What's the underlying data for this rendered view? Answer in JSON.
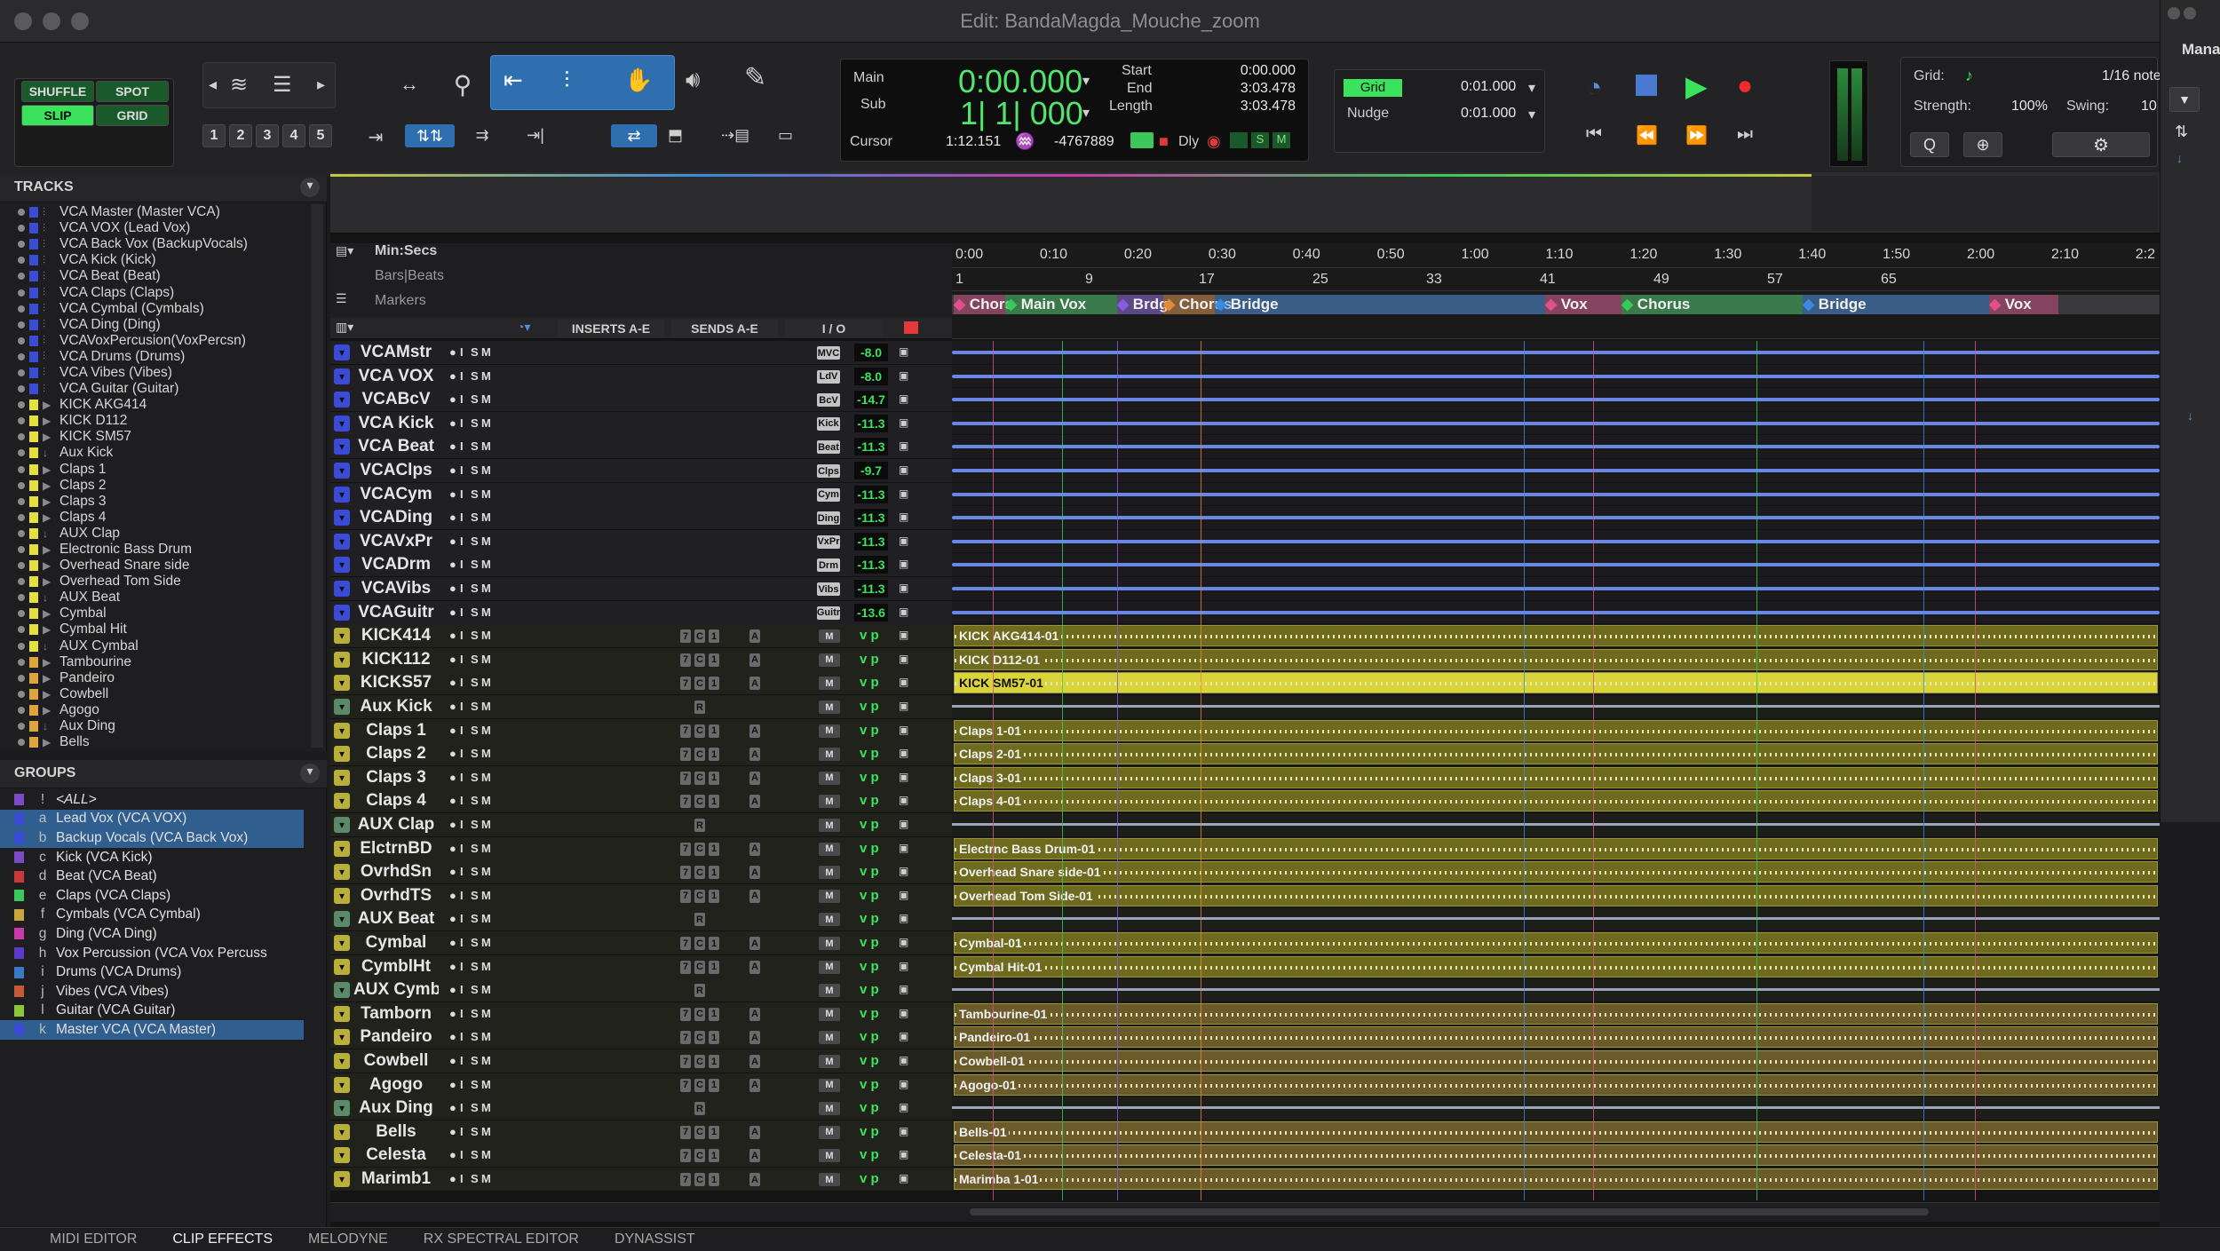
{
  "window": {
    "title": "Edit: BandaMagda_Mouche_zoom"
  },
  "edit_modes": {
    "shuffle": "SHUFFLE",
    "spot": "SPOT",
    "slip": "SLIP",
    "grid": "GRID"
  },
  "zoom_presets": [
    "1",
    "2",
    "3",
    "4",
    "5"
  ],
  "counter": {
    "main_label": "Main",
    "sub_label": "Sub",
    "main_value": "0:00.000",
    "sub_value": "1| 1| 000",
    "start_label": "Start",
    "end_label": "End",
    "length_label": "Length",
    "start_value": "0:00.000",
    "end_value": "3:03.478",
    "length_value": "3:03.478",
    "cursor_label": "Cursor",
    "cursor_value": "1:12.151",
    "cursor_offset": "-4767889",
    "dly_label": "Dly"
  },
  "grid_nudge": {
    "grid_label": "Grid",
    "grid_value": "0:01.000",
    "nudge_label": "Nudge",
    "nudge_value": "0:01.000"
  },
  "midi_panel": {
    "grid_label": "Grid:",
    "grid_value": "1/16 note",
    "strength_label": "Strength:",
    "strength_value": "100%",
    "swing_label": "Swing:",
    "swing_value": "10",
    "manager_label": "Mana"
  },
  "tracks_panel": {
    "title": "TRACKS",
    "items": [
      {
        "name": "VCA Master (Master VCA)",
        "color": "#3a4bd6"
      },
      {
        "name": "VCA VOX (Lead Vox)",
        "color": "#3a4bd6"
      },
      {
        "name": "VCA Back Vox (BackupVocals)",
        "color": "#3a4bd6"
      },
      {
        "name": "VCA Kick (Kick)",
        "color": "#3a4bd6"
      },
      {
        "name": "VCA Beat (Beat)",
        "color": "#3a4bd6"
      },
      {
        "name": "VCA Claps (Claps)",
        "color": "#3a4bd6"
      },
      {
        "name": "VCA Cymbal (Cymbals)",
        "color": "#3a4bd6"
      },
      {
        "name": "VCA Ding (Ding)",
        "color": "#3a4bd6"
      },
      {
        "name": "VCAVoxPercusion(VoxPercsn)",
        "color": "#3a4bd6"
      },
      {
        "name": "VCA Drums (Drums)",
        "color": "#3a4bd6"
      },
      {
        "name": "VCA Vibes (Vibes)",
        "color": "#3a4bd6"
      },
      {
        "name": "VCA Guitar (Guitar)",
        "color": "#3a4bd6"
      },
      {
        "name": "KICK AKG414",
        "color": "#e6e03a"
      },
      {
        "name": "KICK D112",
        "color": "#e6e03a"
      },
      {
        "name": "KICK SM57",
        "color": "#e6e03a"
      },
      {
        "name": "Aux Kick",
        "color": "#e6e03a"
      },
      {
        "name": "Claps 1",
        "color": "#e6e03a"
      },
      {
        "name": "Claps 2",
        "color": "#e6e03a"
      },
      {
        "name": "Claps 3",
        "color": "#e6e03a"
      },
      {
        "name": "Claps 4",
        "color": "#e6e03a"
      },
      {
        "name": "AUX Clap",
        "color": "#e6e03a"
      },
      {
        "name": "Electronic Bass Drum",
        "color": "#e6e03a"
      },
      {
        "name": "Overhead Snare side",
        "color": "#e6e03a"
      },
      {
        "name": "Overhead Tom Side",
        "color": "#e6e03a"
      },
      {
        "name": "AUX Beat",
        "color": "#e6e03a"
      },
      {
        "name": "Cymbal",
        "color": "#e6e03a"
      },
      {
        "name": "Cymbal Hit",
        "color": "#e6e03a"
      },
      {
        "name": "AUX Cymbal",
        "color": "#e6e03a"
      },
      {
        "name": "Tambourine",
        "color": "#e0a43a"
      },
      {
        "name": "Pandeiro",
        "color": "#e0a43a"
      },
      {
        "name": "Cowbell",
        "color": "#e0a43a"
      },
      {
        "name": "Agogo",
        "color": "#e0a43a"
      },
      {
        "name": "Aux Ding",
        "color": "#e0a43a"
      },
      {
        "name": "Bells",
        "color": "#e0a43a"
      }
    ]
  },
  "groups_panel": {
    "title": "GROUPS",
    "items": [
      {
        "letter": "!",
        "name": "<ALL>",
        "color": "#7a4ac8",
        "selected": false
      },
      {
        "letter": "a",
        "name": "Lead Vox (VCA VOX)",
        "color": "#3a4bd6",
        "selected": true
      },
      {
        "letter": "b",
        "name": "Backup Vocals (VCA Back Vox)",
        "color": "#3a4bd6",
        "selected": true
      },
      {
        "letter": "c",
        "name": "Kick (VCA Kick)",
        "color": "#7a4ac8",
        "selected": false
      },
      {
        "letter": "d",
        "name": "Beat (VCA Beat)",
        "color": "#c83a3a",
        "selected": false
      },
      {
        "letter": "e",
        "name": "Claps (VCA Claps)",
        "color": "#3ac85a",
        "selected": false
      },
      {
        "letter": "f",
        "name": "Cymbals (VCA Cymbal)",
        "color": "#c8a83a",
        "selected": false
      },
      {
        "letter": "g",
        "name": "Ding (VCA Ding)",
        "color": "#c83aa8",
        "selected": false
      },
      {
        "letter": "h",
        "name": "Vox Percussion (VCA Vox Percuss",
        "color": "#5a3ac8",
        "selected": false
      },
      {
        "letter": "i",
        "name": "Drums (VCA Drums)",
        "color": "#3a78c8",
        "selected": false
      },
      {
        "letter": "j",
        "name": "Vibes (VCA Vibes)",
        "color": "#c85a3a",
        "selected": false
      },
      {
        "letter": "l",
        "name": "Guitar (VCA Guitar)",
        "color": "#8ac83a",
        "selected": false
      },
      {
        "letter": "k",
        "name": "Master VCA (VCA Master)",
        "color": "#3a4bd6",
        "selected": true
      }
    ]
  },
  "rulers": {
    "minsecs_label": "Min:Secs",
    "bars_label": "Bars|Beats",
    "markers_label": "Markers",
    "inserts_label": "INSERTS A-E",
    "sends_label": "SENDS A-E",
    "io_label": "I / O",
    "time_ticks": [
      "0:00",
      "0:10",
      "0:20",
      "0:30",
      "0:40",
      "0:50",
      "1:00",
      "1:10",
      "1:20",
      "1:30",
      "1:40",
      "1:50",
      "2:00",
      "2:10",
      "2:2"
    ],
    "bar_ticks": [
      "1",
      "9",
      "17",
      "25",
      "33",
      "41",
      "49",
      "57",
      "65"
    ],
    "markers": [
      {
        "name": "Chors",
        "color": "#e0508a"
      },
      {
        "name": "Main Vox",
        "color": "#3ac85a"
      },
      {
        "name": "Brdg",
        "color": "#8a5ae0"
      },
      {
        "name": "Chorus",
        "color": "#e08a3a"
      },
      {
        "name": "Bridge",
        "color": "#3a8ae0"
      },
      {
        "name": "Vox",
        "color": "#e0508a"
      },
      {
        "name": "Chorus",
        "color": "#3ac85a"
      },
      {
        "name": "Bridge",
        "color": "#3a8ae0"
      },
      {
        "name": "Vox",
        "color": "#e0508a"
      }
    ]
  },
  "edit_tracks": [
    {
      "name": "VCAMstr",
      "type": "vca",
      "io": "MVC",
      "vol": "-8.0"
    },
    {
      "name": "VCA VOX",
      "type": "vca",
      "io": "LdV",
      "vol": "-8.0"
    },
    {
      "name": "VCABcV",
      "type": "vca",
      "io": "BcV",
      "vol": "-14.7"
    },
    {
      "name": "VCA Kick",
      "type": "vca",
      "io": "Kick",
      "vol": "-11.3"
    },
    {
      "name": "VCA Beat",
      "type": "vca",
      "io": "Beat",
      "vol": "-11.3"
    },
    {
      "name": "VCAClps",
      "type": "vca",
      "io": "Clps",
      "vol": "-9.7"
    },
    {
      "name": "VCACym",
      "type": "vca",
      "io": "Cym",
      "vol": "-11.3"
    },
    {
      "name": "VCADing",
      "type": "vca",
      "io": "Ding",
      "vol": "-11.3"
    },
    {
      "name": "VCAVxPr",
      "type": "vca",
      "io": "VxPr",
      "vol": "-11.3"
    },
    {
      "name": "VCADrm",
      "type": "vca",
      "io": "Drm",
      "vol": "-11.3"
    },
    {
      "name": "VCAVibs",
      "type": "vca",
      "io": "Vibs",
      "vol": "-11.3"
    },
    {
      "name": "VCAGuitr",
      "type": "vca",
      "io": "Guitr",
      "vol": "-13.6"
    },
    {
      "name": "KICK414",
      "type": "audio",
      "clip": "KICK AKG414-01",
      "color": "#6e6a1e"
    },
    {
      "name": "KICK112",
      "type": "audio",
      "clip": "KICK D112-01",
      "color": "#6e6a1e"
    },
    {
      "name": "KICKS57",
      "type": "audio",
      "clip": "KICK SM57-01",
      "color": "#d9d43a"
    },
    {
      "name": "Aux Kick",
      "type": "aux",
      "clip": "",
      "color": "#6e6a1e"
    },
    {
      "name": "Claps 1",
      "type": "audio",
      "clip": "Claps 1-01",
      "color": "#6e6a1e"
    },
    {
      "name": "Claps 2",
      "type": "audio",
      "clip": "Claps 2-01",
      "color": "#6e6a1e"
    },
    {
      "name": "Claps 3",
      "type": "audio",
      "clip": "Claps 3-01",
      "color": "#6e6a1e"
    },
    {
      "name": "Claps 4",
      "type": "audio",
      "clip": "Claps 4-01",
      "color": "#6e6a1e"
    },
    {
      "name": "AUX Clap",
      "type": "aux",
      "clip": "",
      "color": "#6e6a1e"
    },
    {
      "name": "ElctrnBD",
      "type": "audio",
      "clip": "Electrnc Bass Drum-01",
      "color": "#6e6a1e"
    },
    {
      "name": "OvrhdSn",
      "type": "audio",
      "clip": "Overhead Snare side-01",
      "color": "#6e6a1e"
    },
    {
      "name": "OvrhdTS",
      "type": "audio",
      "clip": "Overhead Tom Side-01",
      "color": "#6e6a1e"
    },
    {
      "name": "AUX Beat",
      "type": "aux",
      "clip": "",
      "color": "#6e6a1e"
    },
    {
      "name": "Cymbal",
      "type": "audio",
      "clip": "Cymbal-01",
      "color": "#6e6a1e"
    },
    {
      "name": "CymblHt",
      "type": "audio",
      "clip": "Cymbal Hit-01",
      "color": "#6e6a1e"
    },
    {
      "name": "AUX Cymbal",
      "type": "aux",
      "clip": "",
      "color": "#6e6a1e"
    },
    {
      "name": "Tamborn",
      "type": "audio",
      "clip": "Tambourine-01",
      "color": "#6b5a2a"
    },
    {
      "name": "Pandeiro",
      "type": "audio",
      "clip": "Pandeiro-01",
      "color": "#6b5a2a"
    },
    {
      "name": "Cowbell",
      "type": "audio",
      "clip": "Cowbell-01",
      "color": "#6b5a2a"
    },
    {
      "name": "Agogo",
      "type": "audio",
      "clip": "Agogo-01",
      "color": "#6b5a2a"
    },
    {
      "name": "Aux Ding",
      "type": "aux",
      "clip": "",
      "color": "#6b5a2a"
    },
    {
      "name": "Bells",
      "type": "audio",
      "clip": "Bells-01",
      "color": "#6b5a2a"
    },
    {
      "name": "Celesta",
      "type": "audio",
      "clip": "Celesta-01",
      "color": "#6b5a2a"
    },
    {
      "name": "Marimb1",
      "type": "audio",
      "clip": "Marimba 1-01",
      "color": "#6b5a2a"
    }
  ],
  "bottom_tabs": [
    "MIDI EDITOR",
    "CLIP EFFECTS",
    "MELODYNE",
    "RX SPECTRAL EDITOR",
    "DYNASSIST"
  ]
}
